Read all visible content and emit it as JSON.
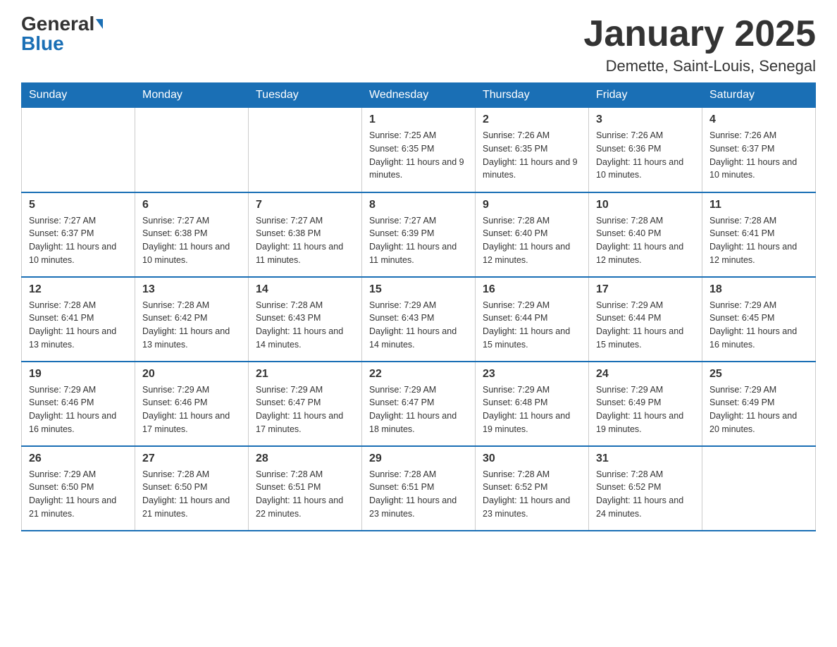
{
  "header": {
    "logo_general": "General",
    "logo_blue": "Blue",
    "month_title": "January 2025",
    "location": "Demette, Saint-Louis, Senegal"
  },
  "weekdays": [
    "Sunday",
    "Monday",
    "Tuesday",
    "Wednesday",
    "Thursday",
    "Friday",
    "Saturday"
  ],
  "weeks": [
    [
      {
        "day": "",
        "info": ""
      },
      {
        "day": "",
        "info": ""
      },
      {
        "day": "",
        "info": ""
      },
      {
        "day": "1",
        "info": "Sunrise: 7:25 AM\nSunset: 6:35 PM\nDaylight: 11 hours and 9 minutes."
      },
      {
        "day": "2",
        "info": "Sunrise: 7:26 AM\nSunset: 6:35 PM\nDaylight: 11 hours and 9 minutes."
      },
      {
        "day": "3",
        "info": "Sunrise: 7:26 AM\nSunset: 6:36 PM\nDaylight: 11 hours and 10 minutes."
      },
      {
        "day": "4",
        "info": "Sunrise: 7:26 AM\nSunset: 6:37 PM\nDaylight: 11 hours and 10 minutes."
      }
    ],
    [
      {
        "day": "5",
        "info": "Sunrise: 7:27 AM\nSunset: 6:37 PM\nDaylight: 11 hours and 10 minutes."
      },
      {
        "day": "6",
        "info": "Sunrise: 7:27 AM\nSunset: 6:38 PM\nDaylight: 11 hours and 10 minutes."
      },
      {
        "day": "7",
        "info": "Sunrise: 7:27 AM\nSunset: 6:38 PM\nDaylight: 11 hours and 11 minutes."
      },
      {
        "day": "8",
        "info": "Sunrise: 7:27 AM\nSunset: 6:39 PM\nDaylight: 11 hours and 11 minutes."
      },
      {
        "day": "9",
        "info": "Sunrise: 7:28 AM\nSunset: 6:40 PM\nDaylight: 11 hours and 12 minutes."
      },
      {
        "day": "10",
        "info": "Sunrise: 7:28 AM\nSunset: 6:40 PM\nDaylight: 11 hours and 12 minutes."
      },
      {
        "day": "11",
        "info": "Sunrise: 7:28 AM\nSunset: 6:41 PM\nDaylight: 11 hours and 12 minutes."
      }
    ],
    [
      {
        "day": "12",
        "info": "Sunrise: 7:28 AM\nSunset: 6:41 PM\nDaylight: 11 hours and 13 minutes."
      },
      {
        "day": "13",
        "info": "Sunrise: 7:28 AM\nSunset: 6:42 PM\nDaylight: 11 hours and 13 minutes."
      },
      {
        "day": "14",
        "info": "Sunrise: 7:28 AM\nSunset: 6:43 PM\nDaylight: 11 hours and 14 minutes."
      },
      {
        "day": "15",
        "info": "Sunrise: 7:29 AM\nSunset: 6:43 PM\nDaylight: 11 hours and 14 minutes."
      },
      {
        "day": "16",
        "info": "Sunrise: 7:29 AM\nSunset: 6:44 PM\nDaylight: 11 hours and 15 minutes."
      },
      {
        "day": "17",
        "info": "Sunrise: 7:29 AM\nSunset: 6:44 PM\nDaylight: 11 hours and 15 minutes."
      },
      {
        "day": "18",
        "info": "Sunrise: 7:29 AM\nSunset: 6:45 PM\nDaylight: 11 hours and 16 minutes."
      }
    ],
    [
      {
        "day": "19",
        "info": "Sunrise: 7:29 AM\nSunset: 6:46 PM\nDaylight: 11 hours and 16 minutes."
      },
      {
        "day": "20",
        "info": "Sunrise: 7:29 AM\nSunset: 6:46 PM\nDaylight: 11 hours and 17 minutes."
      },
      {
        "day": "21",
        "info": "Sunrise: 7:29 AM\nSunset: 6:47 PM\nDaylight: 11 hours and 17 minutes."
      },
      {
        "day": "22",
        "info": "Sunrise: 7:29 AM\nSunset: 6:47 PM\nDaylight: 11 hours and 18 minutes."
      },
      {
        "day": "23",
        "info": "Sunrise: 7:29 AM\nSunset: 6:48 PM\nDaylight: 11 hours and 19 minutes."
      },
      {
        "day": "24",
        "info": "Sunrise: 7:29 AM\nSunset: 6:49 PM\nDaylight: 11 hours and 19 minutes."
      },
      {
        "day": "25",
        "info": "Sunrise: 7:29 AM\nSunset: 6:49 PM\nDaylight: 11 hours and 20 minutes."
      }
    ],
    [
      {
        "day": "26",
        "info": "Sunrise: 7:29 AM\nSunset: 6:50 PM\nDaylight: 11 hours and 21 minutes."
      },
      {
        "day": "27",
        "info": "Sunrise: 7:28 AM\nSunset: 6:50 PM\nDaylight: 11 hours and 21 minutes."
      },
      {
        "day": "28",
        "info": "Sunrise: 7:28 AM\nSunset: 6:51 PM\nDaylight: 11 hours and 22 minutes."
      },
      {
        "day": "29",
        "info": "Sunrise: 7:28 AM\nSunset: 6:51 PM\nDaylight: 11 hours and 23 minutes."
      },
      {
        "day": "30",
        "info": "Sunrise: 7:28 AM\nSunset: 6:52 PM\nDaylight: 11 hours and 23 minutes."
      },
      {
        "day": "31",
        "info": "Sunrise: 7:28 AM\nSunset: 6:52 PM\nDaylight: 11 hours and 24 minutes."
      },
      {
        "day": "",
        "info": ""
      }
    ]
  ]
}
